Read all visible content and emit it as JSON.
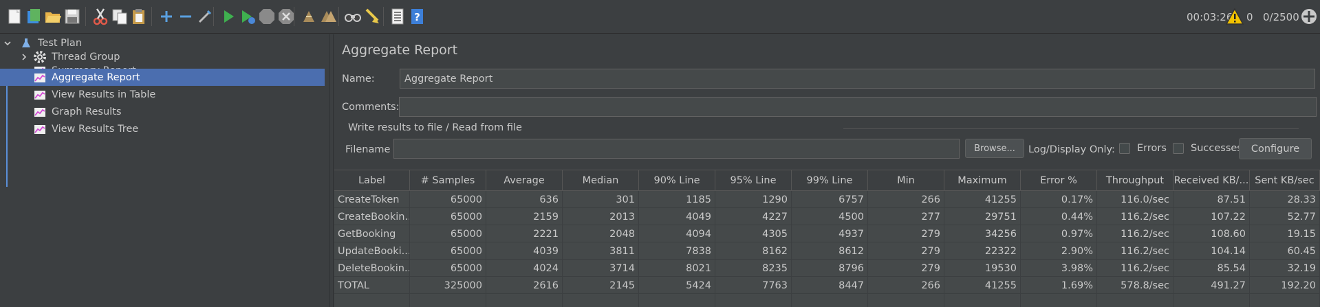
{
  "toolbar": {
    "buttons": [
      "new-icon",
      "templates-icon",
      "open-icon",
      "save-icon",
      "cut-icon",
      "copy-icon",
      "paste-icon",
      "expand-icon",
      "collapse-icon",
      "toggle-icon",
      "start-icon",
      "start-no-pauses-icon",
      "stop-icon",
      "shutdown-icon",
      "clear-icon",
      "clear-all-icon",
      "search-icon",
      "reset-search-icon",
      "function-helper-icon",
      "help-icon"
    ],
    "timer": "00:03:26",
    "warning_count": "0",
    "threads": "0/2500"
  },
  "tree": {
    "root": "Test Plan",
    "items": [
      {
        "label": "Thread Group",
        "icon": "gear-icon"
      },
      {
        "label": "Summary Report",
        "icon": "report-icon"
      },
      {
        "label": "Aggregate Report",
        "icon": "report-icon"
      },
      {
        "label": "View Results in Table",
        "icon": "report-icon"
      },
      {
        "label": "Graph Results",
        "icon": "report-icon"
      },
      {
        "label": "View Results Tree",
        "icon": "report-icon"
      }
    ],
    "selected": "Aggregate Report"
  },
  "panel": {
    "title": "Aggregate Report",
    "name_label": "Name:",
    "name_value": "Aggregate Report",
    "comments_label": "Comments:",
    "comments_value": "",
    "fieldset_legend": "Write results to file / Read from file",
    "filename_label": "Filename",
    "filename_value": "",
    "browse_label": "Browse...",
    "log_display_label": "Log/Display Only:",
    "errors_label": "Errors",
    "successes_label": "Successes",
    "configure_label": "Configure"
  },
  "table": {
    "headers": [
      "Label",
      "# Samples",
      "Average",
      "Median",
      "90% Line",
      "95% Line",
      "99% Line",
      "Min",
      "Maximum",
      "Error %",
      "Throughput",
      "Received KB/...",
      "Sent KB/sec"
    ],
    "rows": [
      [
        "CreateToken",
        "65000",
        "636",
        "301",
        "1185",
        "1290",
        "6757",
        "266",
        "41255",
        "0.17%",
        "116.0/sec",
        "87.51",
        "28.33"
      ],
      [
        "CreateBookin...",
        "65000",
        "2159",
        "2013",
        "4049",
        "4227",
        "4500",
        "277",
        "29751",
        "0.44%",
        "116.2/sec",
        "107.22",
        "52.77"
      ],
      [
        "GetBooking",
        "65000",
        "2221",
        "2048",
        "4094",
        "4305",
        "4937",
        "279",
        "34256",
        "0.97%",
        "116.2/sec",
        "108.60",
        "19.15"
      ],
      [
        "UpdateBooki...",
        "65000",
        "4039",
        "3811",
        "7838",
        "8162",
        "8612",
        "279",
        "22322",
        "2.90%",
        "116.2/sec",
        "104.14",
        "60.45"
      ],
      [
        "DeleteBookin...",
        "65000",
        "4024",
        "3714",
        "8021",
        "8235",
        "8796",
        "279",
        "19530",
        "3.98%",
        "116.2/sec",
        "85.54",
        "32.19"
      ],
      [
        "TOTAL",
        "325000",
        "2616",
        "2145",
        "5424",
        "7763",
        "8447",
        "266",
        "41255",
        "1.69%",
        "578.8/sec",
        "491.27",
        "192.20"
      ]
    ]
  }
}
